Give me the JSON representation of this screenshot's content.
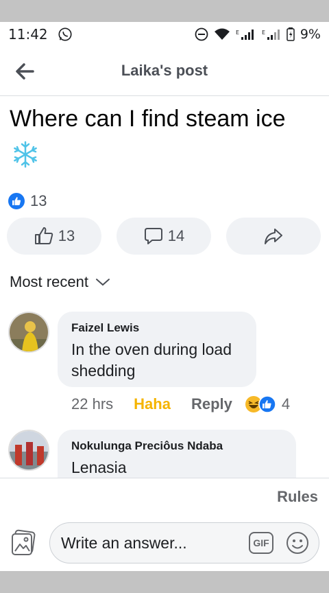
{
  "status_bar": {
    "time": "11:42",
    "battery": "9%"
  },
  "header": {
    "title": "Laika's post"
  },
  "post": {
    "text": "Where can I find steam ice",
    "reaction_count": "13",
    "like_count": "13",
    "comment_count": "14"
  },
  "sort": {
    "label": "Most recent"
  },
  "comments": [
    {
      "author": "Faizel Lewis",
      "text": "In the oven  during load shedding",
      "time": "22 hrs",
      "reaction": "Haha",
      "reply": "Reply",
      "reaction_count": "4"
    },
    {
      "author": "Nokulunga Preciôus Ndaba",
      "text": "Lenasia"
    }
  ],
  "composer": {
    "rules": "Rules",
    "placeholder": "Write an answer...",
    "gif_label": "GIF"
  },
  "colors": {
    "accent": "#1877f2",
    "haha": "#f5b400",
    "muted": "#65676b"
  }
}
